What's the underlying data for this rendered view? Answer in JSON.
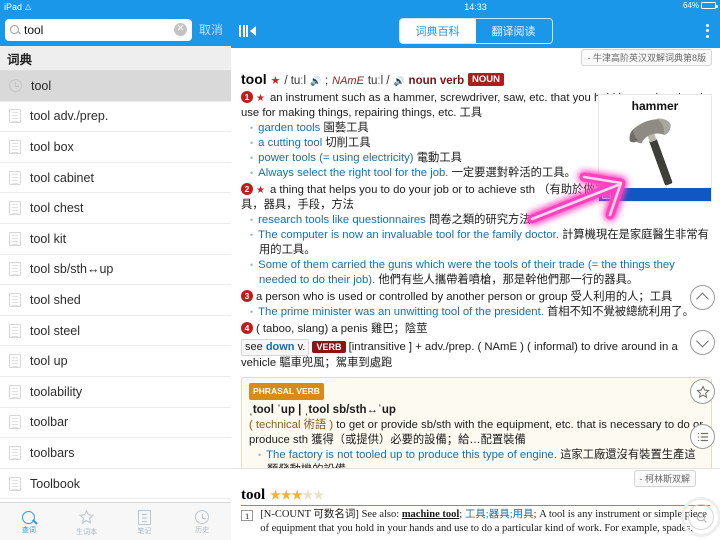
{
  "status": {
    "device": "iPad",
    "wifi_icon": "wifi-icon",
    "time": "14:33",
    "battery_pct": "64%"
  },
  "search": {
    "value": "tool",
    "placeholder": "",
    "cancel_label": "取消",
    "clear_icon": "clear-icon",
    "search_icon": "search-icon"
  },
  "sidebar": {
    "header": "词典",
    "items": [
      {
        "label": "tool",
        "icon": "history-clock-icon",
        "selected": true
      },
      {
        "label": "tool adv./prep.",
        "icon": "document-icon",
        "selected": false
      },
      {
        "label": "tool box",
        "icon": "document-icon",
        "selected": false
      },
      {
        "label": "tool cabinet",
        "icon": "document-icon",
        "selected": false
      },
      {
        "label": "tool chest",
        "icon": "document-icon",
        "selected": false
      },
      {
        "label": "tool kit",
        "icon": "document-icon",
        "selected": false
      },
      {
        "label": "tool sb/sth↔up",
        "icon": "document-icon",
        "selected": false
      },
      {
        "label": "tool shed",
        "icon": "document-icon",
        "selected": false
      },
      {
        "label": "tool steel",
        "icon": "document-icon",
        "selected": false
      },
      {
        "label": "tool up",
        "icon": "document-icon",
        "selected": false
      },
      {
        "label": "toolability",
        "icon": "document-icon",
        "selected": false
      },
      {
        "label": "toolbar",
        "icon": "document-icon",
        "selected": false
      },
      {
        "label": "toolbars",
        "icon": "document-icon",
        "selected": false
      },
      {
        "label": "Toolbook",
        "icon": "document-icon",
        "selected": false
      }
    ],
    "tabs": [
      {
        "label": "查词",
        "icon": "search-icon",
        "active": true
      },
      {
        "label": "生词本",
        "icon": "star-icon",
        "active": false
      },
      {
        "label": "笔记",
        "icon": "note-icon",
        "active": false
      },
      {
        "label": "历史",
        "icon": "clock-icon",
        "active": false
      }
    ]
  },
  "navbar": {
    "panel_toggle_icon": "collapse-sidebar-icon",
    "more_icon": "more-vertical-icon",
    "segments": [
      {
        "label": "词典百科",
        "active": true
      },
      {
        "label": "翻译阅读",
        "active": false
      }
    ]
  },
  "oxford": {
    "dict_tag": "- 牛津高阶英汉双解词典第8版",
    "headword": "tool",
    "star": "★",
    "phonetic_br": "/ tuːl",
    "phonetic_us_label": "NAmE",
    "phonetic_us": "tuːl /",
    "pos": "noun verb",
    "pos_badge": "NOUN",
    "speaker_icon": "speaker-icon",
    "senses": [
      {
        "num": "1",
        "star": "★",
        "def_en": "an instrument such as a hammer, screwdriver, saw, etc. that you hold in your hand and use for making things, repairing things, etc.",
        "def_cn": "工具",
        "examples": [
          {
            "en": "garden tools",
            "cn": "園藝工具"
          },
          {
            "en": "a cutting tool",
            "cn": "切削工具"
          },
          {
            "en": "power tools (= using electricity)",
            "cn": "電動工具"
          },
          {
            "en": "Always select the right tool for the job.",
            "cn": "一定要選對幹活的工具。"
          }
        ]
      },
      {
        "num": "2",
        "star": "★",
        "def_en": "a thing that helps you to do your job or to achieve sth",
        "def_cn": "（有助於做工或完成某事的）用具，器具，手段，方法",
        "examples": [
          {
            "en": "research tools like questionnaires",
            "cn": "問卷之類的研究方法"
          },
          {
            "en": "The computer is now an invaluable tool for the family doctor.",
            "cn": "計算機現在是家庭醫生非常有用的工具。"
          },
          {
            "en": "Some of them carried the guns which were the tools of their trade (= the things they needed to do their job).",
            "cn": "他們有些人攜帶着噴槍，那是幹他們那一行的器具。"
          }
        ]
      },
      {
        "num": "3",
        "star": "",
        "def_en": "a person who is used or controlled by another person or group",
        "def_cn": "受人利用的人；工具",
        "examples": [
          {
            "en": "The prime minister was an unwitting tool of the president.",
            "cn": "首相不知不覺被總統利用了。"
          }
        ]
      },
      {
        "num": "4",
        "star": "",
        "def_en": "( taboo, slang) a penis",
        "def_cn": "雞巴；陰莖",
        "examples": []
      }
    ],
    "see_also": {
      "label": "see",
      "word": "down",
      "pos": "v."
    },
    "verb_badge": "VERB",
    "verb_def_en": "[intransitive ] + adv./prep. ( NAmE ) ( informal) to drive around in a vehicle",
    "verb_def_cn": "驅車兜風；駕車到處跑",
    "phrasal_verb": {
      "badge": "PHRASAL VERB",
      "headword": "ˌtool ˈup | ˌtool sb/sth↔ˈup",
      "register": "( technical 術語 )",
      "def_en": "to get or provide sb/sth with the equipment, etc. that is necessary to do or produce sth",
      "def_cn": "獲得（或提供）必要的設備；給…配置裝備",
      "examples": [
        {
          "en": "The factory is not tooled up to produce this type of engine.",
          "cn": "這家工廠還沒有裝置生產這類發動機的設備。"
        }
      ]
    },
    "figure": {
      "caption": "hammer",
      "image_alt": "hammer-illustration",
      "selection_icon": "image-thumb-icon"
    },
    "annotation": {
      "type": "pink-arrow",
      "color": "#ff49c8",
      "points_to": "hammer-figure"
    },
    "rail_buttons": [
      {
        "icon": "chevron-up-icon",
        "name": "scroll-up-button"
      },
      {
        "icon": "chevron-down-icon",
        "name": "scroll-down-button"
      },
      {
        "icon": "star-icon",
        "name": "favorite-button"
      },
      {
        "icon": "list-icon",
        "name": "outline-button"
      },
      {
        "icon": "speaker-icon",
        "name": "pronounce-button"
      }
    ]
  },
  "collins": {
    "dict_tag": "- 柯林斯双解",
    "headword": "tool",
    "stars_filled": 3,
    "stars_total": 5,
    "entry_num": "1",
    "grammar": "[N-COUNT 可数名词]",
    "see_also_label": "See also:",
    "see_also_word": "machine tool",
    "cn_gloss": "工具;器具;用具",
    "text": "A tool is any instrument or simple piece of equipment that you hold in your hands and use to do a particular kind of work. For example, spades,",
    "zoom_icon": "zoom-out-icon"
  }
}
